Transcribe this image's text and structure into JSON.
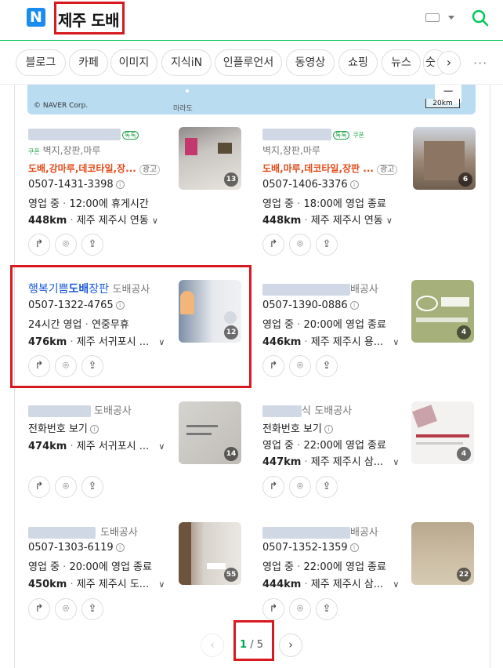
{
  "header": {
    "logo": "N",
    "query": "제주 도배"
  },
  "tabs": [
    "블로그",
    "카페",
    "이미지",
    "지식iN",
    "인플루언서",
    "동영상",
    "쇼핑",
    "뉴스",
    "숫"
  ],
  "map": {
    "copyright": "© NAVER Corp.",
    "label": "마라도",
    "scale": "20km",
    "zoom_out": "−"
  },
  "labels": {
    "talk": "톡톡",
    "coupon": "쿠폰",
    "ad": "광고",
    "chevron": "∨",
    "phone_view": "전화번호 보기"
  },
  "cards": [
    {
      "name": "",
      "category": "",
      "talk": true,
      "coupon": true,
      "tags": "벽지,장판,마루",
      "ad": "도배,강마루,데코타일,장...",
      "phone": "0507-1431-3398",
      "status": "영업 중",
      "hours": "12:00에 휴게시간",
      "distance": "448km",
      "address": "제주 제주시 연동",
      "photos": "13"
    },
    {
      "name": "",
      "category": "",
      "talk": true,
      "coupon": true,
      "tags": "벽지,장판,마루",
      "ad": "도배,마루,데코타일,장판 ...",
      "phone": "0507-1406-3376",
      "status": "영업 중",
      "hours": "18:00에 영업 종료",
      "distance": "448km",
      "address": "제주 제주시 연동",
      "photos": "6"
    },
    {
      "name_pre": "행복기쁨",
      "name_bold": "도배",
      "name_post": "장판",
      "category": "도배공사",
      "phone": "0507-1322-4765",
      "status": "24시간 영업",
      "hours": "연중무휴",
      "distance": "476km",
      "address": "제주 서귀포시 ...",
      "photos": "12"
    },
    {
      "name": "배공사",
      "category": "",
      "phone": "0507-1390-0886",
      "status": "영업 중",
      "hours": "20:00에 영업 종료",
      "distance": "446km",
      "address": "제주 제주시 용...",
      "photos": "4"
    },
    {
      "name": "",
      "category": "도배공사",
      "status": "",
      "distance": "474km",
      "address": "제주 서귀포시 ...",
      "photos": "14"
    },
    {
      "name": "식",
      "category": "도배공사",
      "status": "영업 중",
      "hours": "22:00에 영업 종료",
      "distance": "447km",
      "address": "제주 제주시 삼...",
      "photos": "4"
    },
    {
      "name": "",
      "category": "도배공사",
      "phone": "0507-1303-6119",
      "status": "영업 중",
      "hours": "20:00에 영업 종료",
      "distance": "450km",
      "address": "제주 제주시 도...",
      "photos": "55"
    },
    {
      "name": "배공사",
      "category": "",
      "phone": "0507-1352-1359",
      "status": "영업 중",
      "hours": "22:00에 영업 종료",
      "distance": "444km",
      "address": "제주 제주시 삼...",
      "photos": "22"
    }
  ],
  "pagination": {
    "current": "1",
    "separator": "/",
    "total": "5",
    "prev": "‹",
    "next": "›"
  },
  "icons": {
    "share": "share-icon",
    "pin": "location-pin-icon",
    "route": "directions-icon"
  }
}
